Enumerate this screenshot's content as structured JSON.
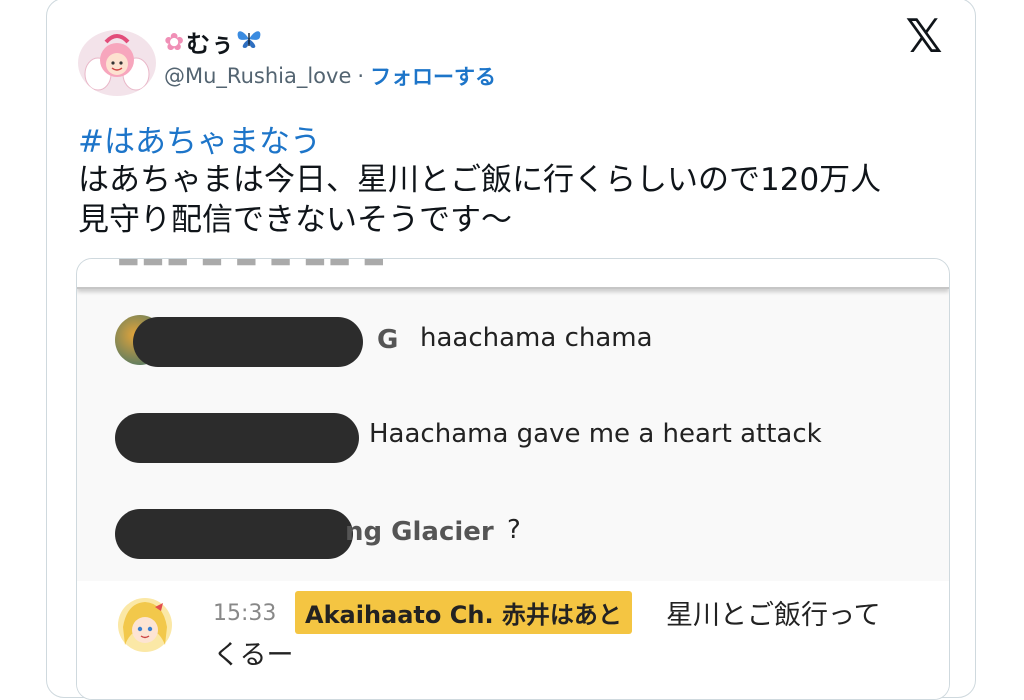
{
  "author": {
    "display_name": "むぅ",
    "handle": "@Mu_Rushia_love",
    "separator": "·",
    "follow_label": "フォローする",
    "flower_icon": "cherry-blossom-icon",
    "butterfly_icon": "butterfly-icon"
  },
  "x_logo": "𝕏",
  "tweet": {
    "hashtag": "#はあちゃまなう",
    "line1": "はあちゃまは今日、星川とご飯に行くらしいので120万人",
    "line2": "見守り配信できないそうです～"
  },
  "chat": {
    "messages": [
      {
        "name_tail": "G",
        "text": "haachama chama"
      },
      {
        "name_tail": "",
        "text": "Haachama gave me a heart attack"
      },
      {
        "name_tail": "ng Glacier",
        "text": "?"
      }
    ],
    "owner": {
      "time": "15:33",
      "name": "Akaihaato Ch. 赤井はあと",
      "text_line1": "星川とご飯行って",
      "text_line2": "くるー"
    }
  },
  "colors": {
    "link": "#1d75c9",
    "owner_badge": "#f4c542",
    "redaction": "#2c2c2c"
  }
}
